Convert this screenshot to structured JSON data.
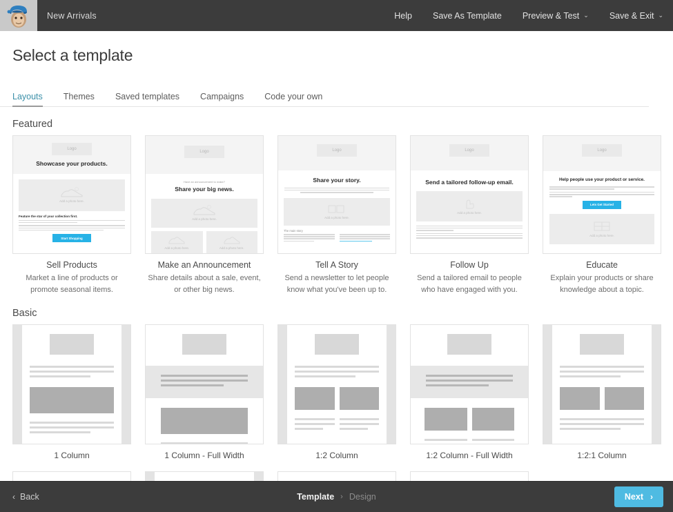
{
  "topbar": {
    "logo_icon": "mailchimp-freddie-icon",
    "campaign_name": "New Arrivals",
    "nav": [
      {
        "label": "Help",
        "caret": ""
      },
      {
        "label": "Save As Template",
        "caret": ""
      },
      {
        "label": "Preview & Test",
        "caret": "⌄"
      },
      {
        "label": "Save & Exit",
        "caret": "⌄"
      }
    ]
  },
  "page": {
    "title": "Select a template"
  },
  "tabs": [
    {
      "label": "Layouts",
      "active": true
    },
    {
      "label": "Themes",
      "active": false
    },
    {
      "label": "Saved templates",
      "active": false
    },
    {
      "label": "Campaigns",
      "active": false
    },
    {
      "label": "Code your own",
      "active": false
    }
  ],
  "featured": {
    "heading": "Featured",
    "cards": [
      {
        "name": "Sell Products",
        "description": "Market a line of products or promote seasonal items.",
        "preview": {
          "logo": "Logo",
          "eyebrow": "",
          "headline": "Showcase your products.",
          "photo_caption": "Add a photo here.",
          "subhead": "Feature the star of your collection first.",
          "button": "Start Shopping"
        }
      },
      {
        "name": "Make an Announcement",
        "description": "Share details about a sale, event, or other big news.",
        "preview": {
          "logo": "Logo",
          "eyebrow": "Have an announcement to make?",
          "headline": "Share your big news.",
          "photo_caption": "Add a photo here.",
          "photo_caption_left": "Add a photo here.",
          "photo_caption_right": "Add a photo here."
        }
      },
      {
        "name": "Tell A Story",
        "description": "Send a newsletter to let people know what you've been up to.",
        "preview": {
          "logo": "Logo",
          "headline": "Share your story.",
          "photo_caption": "Add a photo here.",
          "subhead": "The main story",
          "col_left": "Make your story easy to scan by leading with one big feature or idea.",
          "col_right": "Start by replacing the Mailchimp favicon and feature image with your own."
        }
      },
      {
        "name": "Follow Up",
        "description": "Send a tailored email to people who have engaged with you.",
        "preview": {
          "logo": "Logo",
          "headline": "Send a tailored follow-up email.",
          "photo_caption": "Add a photo here."
        }
      },
      {
        "name": "Educate",
        "description": "Explain your products or share knowledge about a topic.",
        "preview": {
          "logo": "Logo",
          "headline": "Help people use your product or service.",
          "button": "Lets Get Started",
          "photo_caption": "Add a photo here."
        }
      }
    ]
  },
  "basic": {
    "heading": "Basic",
    "cards": [
      {
        "name": "1 Column",
        "layout": "one-col"
      },
      {
        "name": "1 Column - Full Width",
        "layout": "one-col-full"
      },
      {
        "name": "1:2 Column",
        "layout": "one-two-col"
      },
      {
        "name": "1:2 Column - Full Width",
        "layout": "one-two-col-full"
      },
      {
        "name": "1:2:1 Column",
        "layout": "one-two-one-col"
      }
    ]
  },
  "partial_row": [
    {
      "layout": "boxed"
    },
    {
      "layout": "full-width"
    },
    {
      "layout": "boxed"
    },
    {
      "layout": "plain"
    }
  ],
  "footer": {
    "back_label": "Back",
    "back_icon": "chevron-left-icon",
    "breadcrumb_current": "Template",
    "breadcrumb_sep_icon": "chevron-right-icon",
    "breadcrumb_next": "Design",
    "next_label": "Next",
    "next_icon": "chevron-right-icon"
  },
  "colors": {
    "chrome": "#3c3c3c",
    "accent_blue": "#4fbbe2",
    "tab_active": "#3a8fa8",
    "preview_button": "#27b2e6"
  }
}
